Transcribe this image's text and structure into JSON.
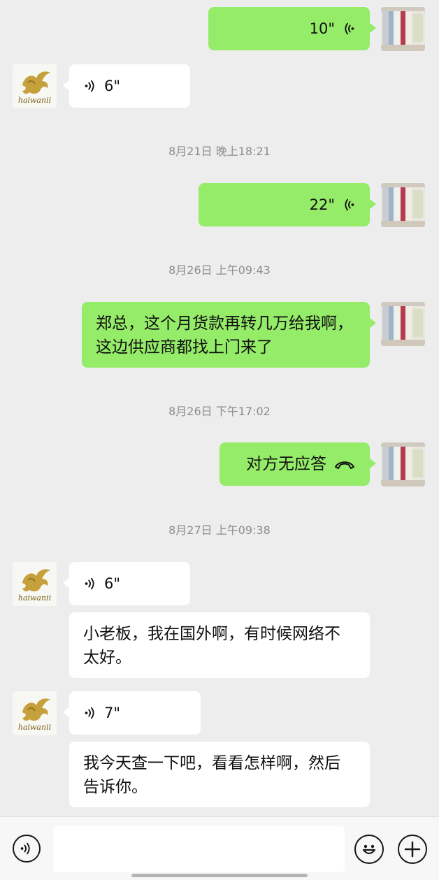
{
  "messages": [
    {
      "type": "voice",
      "side": "self",
      "duration": "10\""
    },
    {
      "type": "voice",
      "side": "other",
      "duration": "6\""
    },
    {
      "type": "voice",
      "side": "self",
      "duration": "22\""
    },
    {
      "type": "text",
      "side": "self",
      "text": "郑总，这个月货款再转几万给我啊，这边供应商都找上门来了"
    },
    {
      "type": "call",
      "side": "self",
      "text": "对方无应答"
    },
    {
      "type": "voice",
      "side": "other",
      "duration": "6\""
    },
    {
      "type": "text",
      "side": "other",
      "text": "小老板，我在国外啊，有时候网络不太好。"
    },
    {
      "type": "voice",
      "side": "other",
      "duration": "7\""
    },
    {
      "type": "text",
      "side": "other",
      "text": "我今天查一下吧，看看怎样啊，然后告诉你。"
    }
  ],
  "timestamps": [
    "8月21日 晚上18:21",
    "8月26日 上午09:43",
    "8月26日 下午17:02",
    "8月27日 上午09:38"
  ],
  "avatars": {
    "other_logo_text": "haiwanii",
    "self_icon": "curtain-photo",
    "other_icon": "golden-pegasus-logo"
  },
  "input_bar": {
    "voice_icon": "voice-toggle-icon",
    "emoji_icon": "emoji-icon",
    "plus_icon": "plus-icon",
    "placeholder": ""
  },
  "colors": {
    "self_bubble": "#95ec69",
    "other_bubble": "#ffffff",
    "background": "#ededed",
    "timestamp": "#8c8c8c"
  }
}
